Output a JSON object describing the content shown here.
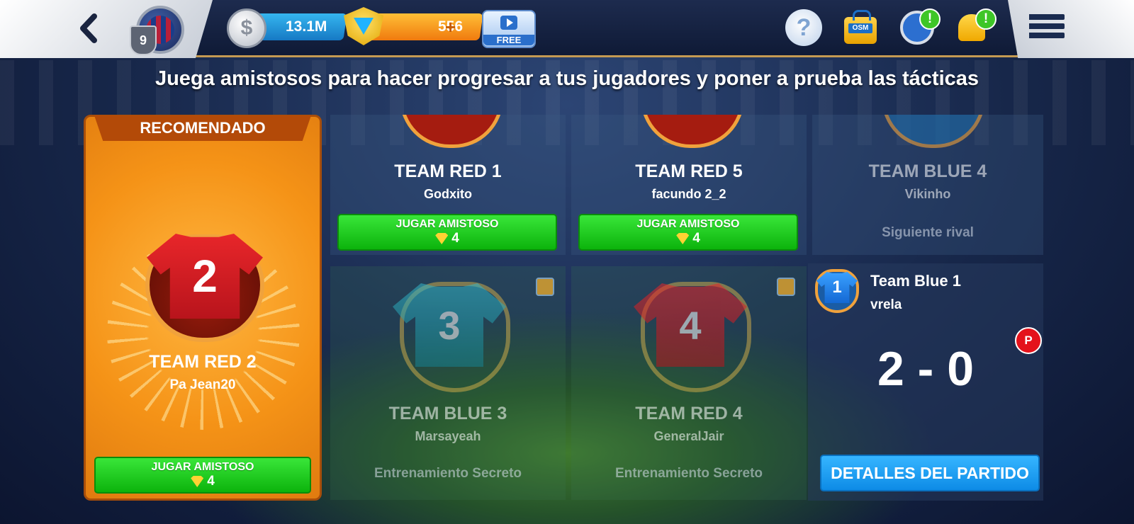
{
  "topbar": {
    "level": "9",
    "coins": "13.1M",
    "gems": "556",
    "gems_plus": "+",
    "free_label": "FREE",
    "shop_label": "OSM",
    "timer_alert": "!",
    "bell_alert": "!",
    "help_glyph": "?",
    "back_glyph": "‹"
  },
  "headline": "Juega amistosos para hacer progresar a tus jugadores y poner a prueba las tácticas",
  "recommended": {
    "banner": "RECOMENDADO",
    "jersey_number": "2",
    "team": "TEAM RED 2",
    "manager": "Pa Jean20",
    "button_label": "JUGAR AMISTOSO",
    "cost": "4"
  },
  "opponents": [
    {
      "team": "TEAM RED 1",
      "manager": "Godxito",
      "button_label": "JUGAR AMISTOSO",
      "cost": "4"
    },
    {
      "team": "TEAM RED 5",
      "manager": "facundo 2_2",
      "button_label": "JUGAR AMISTOSO",
      "cost": "4"
    },
    {
      "team": "TEAM BLUE 4",
      "manager": "Vikinho",
      "status": "Siguiente rival"
    },
    {
      "team": "TEAM BLUE 3",
      "manager": "Marsayeah",
      "jersey_number": "3",
      "status": "Entrenamiento Secreto"
    },
    {
      "team": "TEAM RED 4",
      "manager": "GeneralJair",
      "jersey_number": "4",
      "status": "Entrenamiento Secreto"
    }
  ],
  "last_match": {
    "jersey_number": "1",
    "team": "Team Blue 1",
    "manager": "vrela",
    "badge": "P",
    "score": "2 - 0",
    "button_label": "DETALLES DEL PARTIDO"
  },
  "colors": {
    "accent_green": "#17c417",
    "accent_blue": "#1499f0",
    "recommended_orange": "#f59317",
    "alert_green": "#3ec627",
    "badge_red": "#e4121b"
  },
  "icons": [
    "back-icon",
    "club-badge",
    "coin-icon",
    "gem-icon",
    "free-video-icon",
    "help-icon",
    "shop-icon",
    "timer-icon",
    "bell-icon",
    "menu-icon",
    "lock-icon"
  ]
}
